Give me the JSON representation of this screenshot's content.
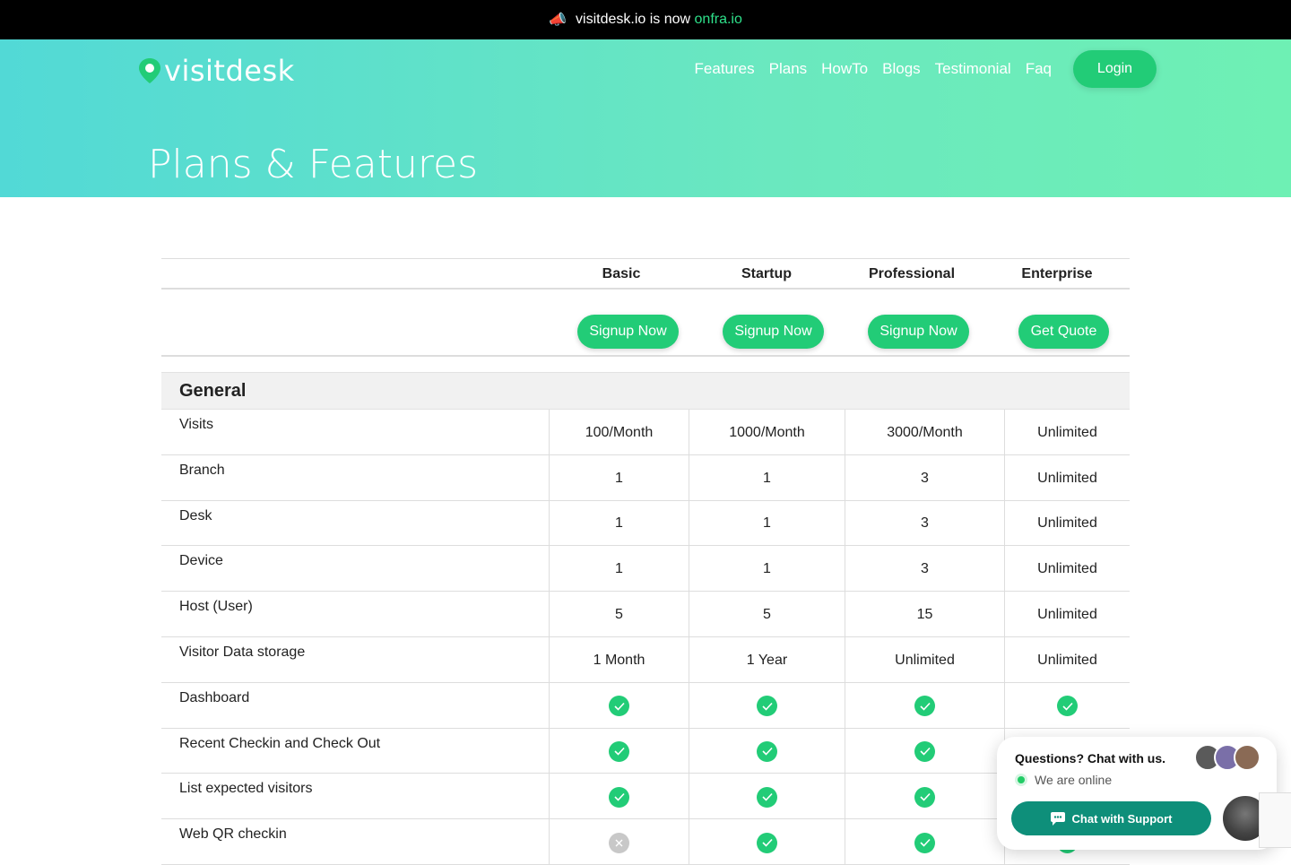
{
  "announcement": {
    "text": "visitdesk.io is now",
    "new_brand": "onfra.io",
    "icon": "megaphone-icon"
  },
  "brand": {
    "name": "visitdesk",
    "icon": "location-pin-icon",
    "accent": "#22cc77"
  },
  "nav": {
    "items": [
      "Features",
      "Plans",
      "HowTo",
      "Blogs",
      "Testimonial",
      "Faq"
    ],
    "login": "Login"
  },
  "page_title": "Plans & Features",
  "plans": [
    {
      "name": "Basic",
      "cta": "Signup Now"
    },
    {
      "name": "Startup",
      "cta": "Signup Now"
    },
    {
      "name": "Professional",
      "cta": "Signup Now"
    },
    {
      "name": "Enterprise",
      "cta": "Get Quote"
    }
  ],
  "section": "General",
  "rows": [
    {
      "label": "Visits",
      "values": [
        "100/Month",
        "1000/Month",
        "3000/Month",
        "Unlimited"
      ]
    },
    {
      "label": "Branch",
      "values": [
        "1",
        "1",
        "3",
        "Unlimited"
      ]
    },
    {
      "label": "Desk",
      "values": [
        "1",
        "1",
        "3",
        "Unlimited"
      ]
    },
    {
      "label": "Device",
      "values": [
        "1",
        "1",
        "3",
        "Unlimited"
      ]
    },
    {
      "label": "Host (User)",
      "values": [
        "5",
        "5",
        "15",
        "Unlimited"
      ]
    },
    {
      "label": "Visitor Data storage",
      "values": [
        "1 Month",
        "1 Year",
        "Unlimited",
        "Unlimited"
      ]
    },
    {
      "label": "Dashboard",
      "values": [
        "check",
        "check",
        "check",
        "check"
      ]
    },
    {
      "label": "Recent Checkin and Check Out",
      "values": [
        "check",
        "check",
        "check",
        "check"
      ]
    },
    {
      "label": "List expected visitors",
      "values": [
        "check",
        "check",
        "check",
        "check"
      ]
    },
    {
      "label": "Web QR checkin",
      "values": [
        "cross",
        "check",
        "check",
        "check"
      ]
    }
  ],
  "chat": {
    "question": "Questions? Chat with us.",
    "status": "We are online",
    "button": "Chat with Support"
  }
}
